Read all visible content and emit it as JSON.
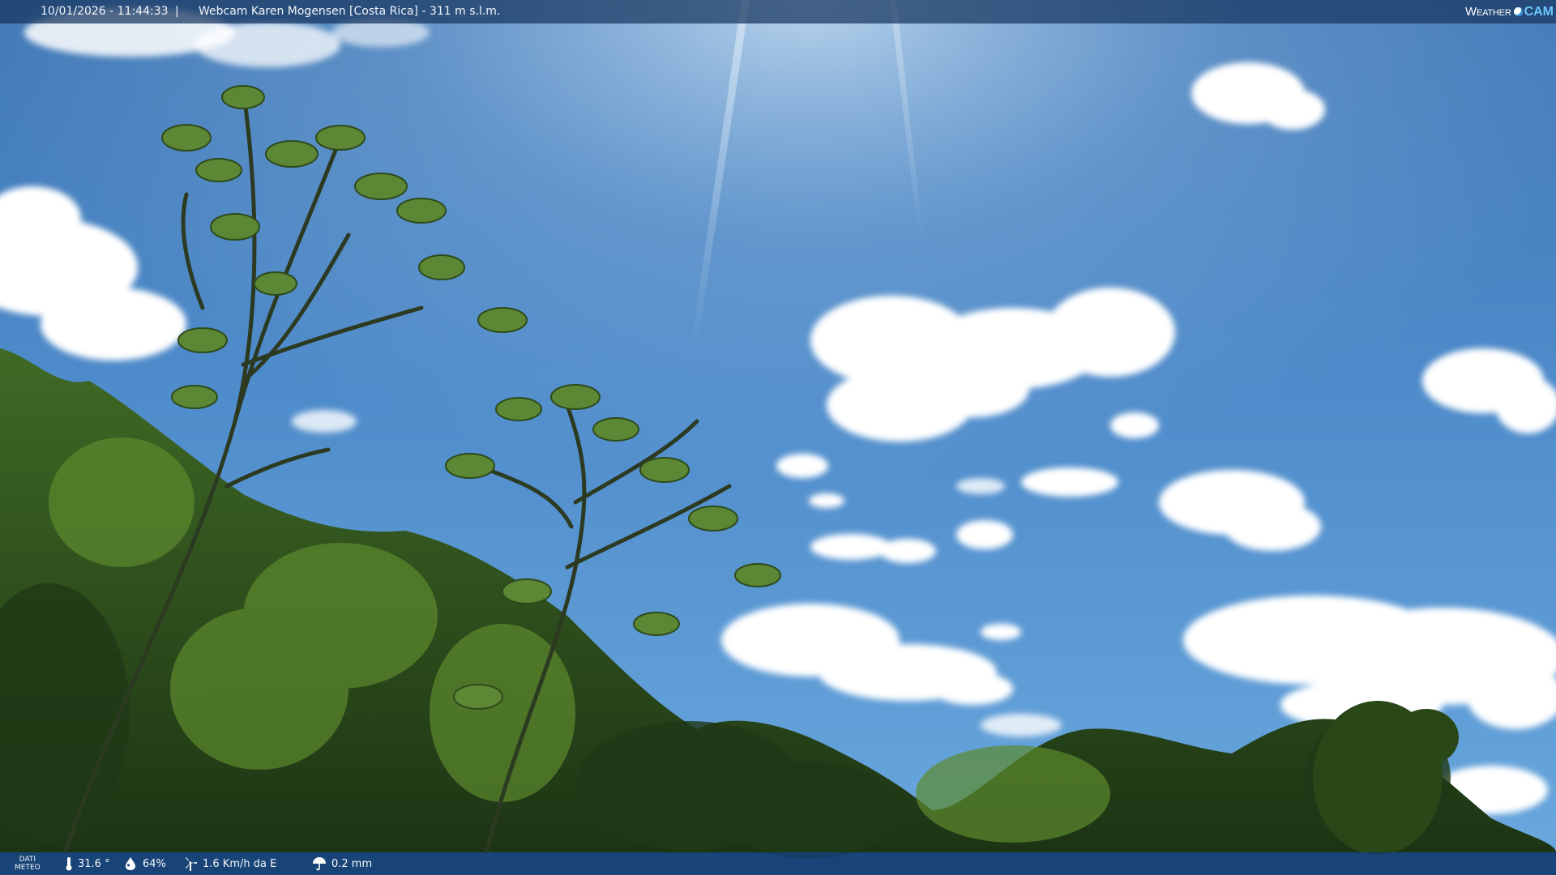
{
  "top_bar": {
    "timestamp": "10/01/2026 - 11:44:33",
    "separator": "|",
    "camera_title": "Webcam Karen Mogensen [Costa Rica] - 311 m s.l.m.",
    "logo_part1": "Weather",
    "logo_part2": "CAM"
  },
  "bottom_bar": {
    "label_line1": "DATI",
    "label_line2": "METEO",
    "temperature": "31.6 °",
    "humidity": "64%",
    "wind": "1.6 Km/h da E",
    "rain": "0.2 mm"
  },
  "colors": {
    "bar_background": "#183660",
    "bar_text": "#f2f6fb",
    "logo_accent": "#6cc6ff",
    "sky_top": "#4d86c2",
    "sky_bottom": "#6aa6dd",
    "foliage": "#2e4d1e"
  },
  "icons": {
    "temperature": "thermometer-icon",
    "humidity": "humidity-icon",
    "wind": "wind-turbine-icon",
    "rain": "rain-umbrella-icon"
  }
}
